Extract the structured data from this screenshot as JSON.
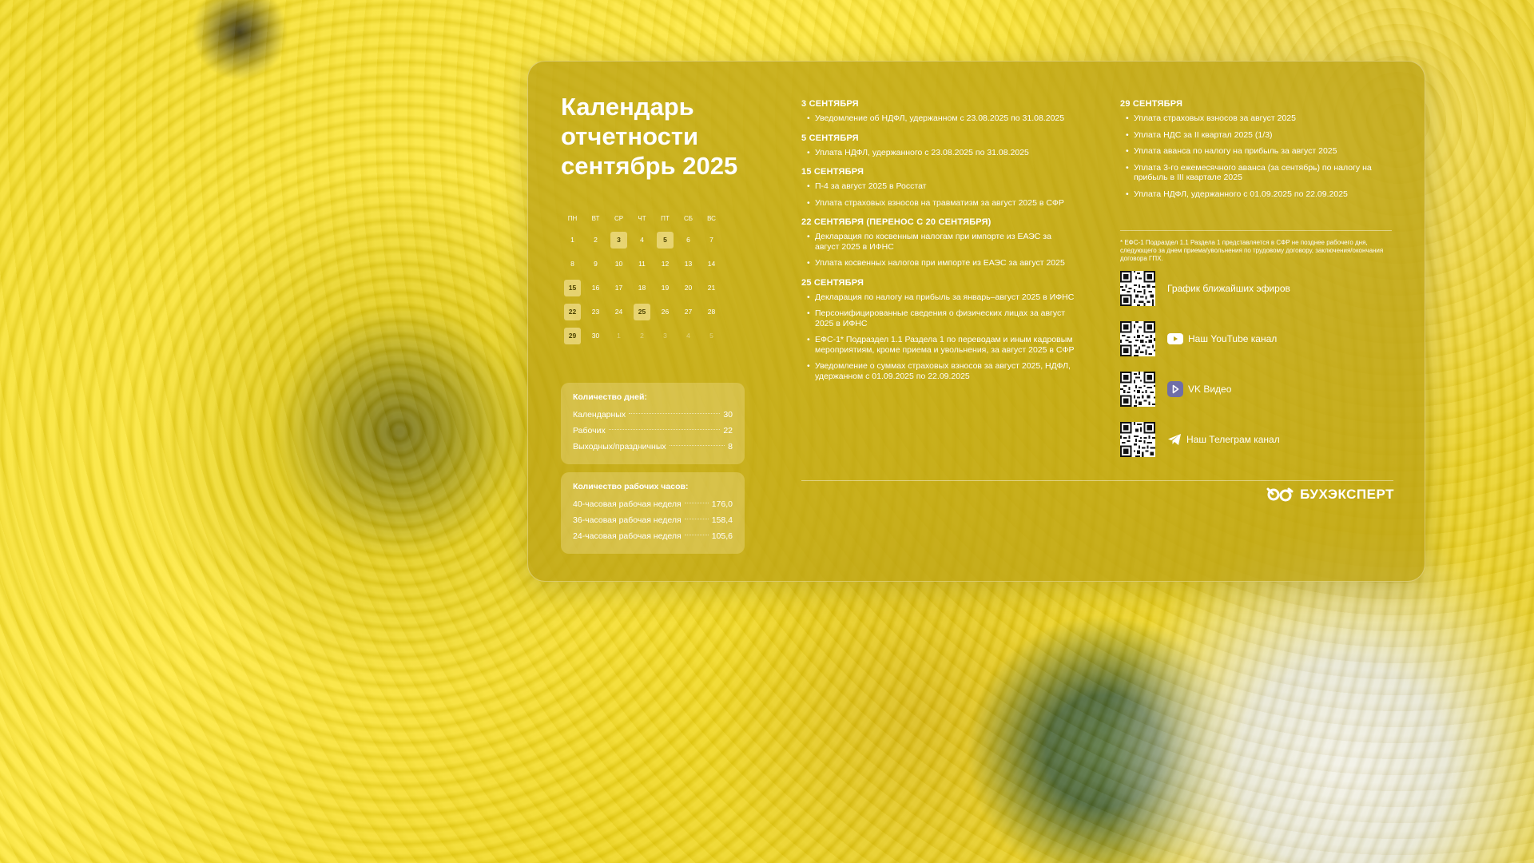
{
  "title": {
    "line1": "Календарь",
    "line2": "отчетности",
    "line3": "сентябрь 2025"
  },
  "calendar": {
    "weekdays": [
      "пн",
      "вт",
      "ср",
      "чт",
      "пт",
      "сб",
      "вс"
    ],
    "weeks": [
      [
        "1",
        "2",
        "3",
        "4",
        "5",
        "6",
        "7"
      ],
      [
        "8",
        "9",
        "10",
        "11",
        "12",
        "13",
        "14"
      ],
      [
        "15",
        "16",
        "17",
        "18",
        "19",
        "20",
        "21"
      ],
      [
        "22",
        "23",
        "24",
        "25",
        "26",
        "27",
        "28"
      ],
      [
        "29",
        "30",
        "1",
        "2",
        "3",
        "4",
        "5"
      ]
    ]
  },
  "days_count": {
    "heading": "Количество дней:",
    "rows": [
      {
        "label": "Календарных",
        "value": "30"
      },
      {
        "label": "Рабочих",
        "value": "22"
      },
      {
        "label": "Выходных/праздничных",
        "value": "8"
      }
    ]
  },
  "hours_count": {
    "heading": "Количество рабочих часов:",
    "rows": [
      {
        "label": "40-часовая рабочая неделя",
        "value": "176,0"
      },
      {
        "label": "36-часовая рабочая неделя",
        "value": "158,4"
      },
      {
        "label": "24-часовая рабочая неделя",
        "value": "105,6"
      }
    ]
  },
  "sections_left": [
    {
      "date": "3 сентября",
      "items": [
        "Уведомление об НДФЛ, удержанном с 23.08.2025 по 31.08.2025"
      ]
    },
    {
      "date": "5 сентября",
      "items": [
        "Уплата НДФЛ, удержанного с 23.08.2025 по 31.08.2025"
      ]
    },
    {
      "date": "15 сентября",
      "items": [
        "П-4 за август 2025 в Росстат",
        "Уплата страховых взносов на травматизм за август 2025 в СФР"
      ]
    },
    {
      "date": "22 сентября (перенос с 20 сентября)",
      "items": [
        "Декларация по косвенным налогам при импорте из ЕАЭС за август 2025 в ИФНС",
        "Уплата косвенных налогов при импорте из ЕАЭС за август 2025"
      ]
    },
    {
      "date": "25 сентября",
      "items": [
        "Декларация по налогу на прибыль за январь–август 2025 в ИФНС",
        "Персонифицированные сведения о физических лицах за август 2025 в ИФНС",
        "ЕФС-1* Подраздел 1.1 Раздела 1 по переводам и иным кадровым мероприятиям, кроме приема и увольнения, за август 2025 в СФР",
        "Уведомление о суммах страховых взносов за август 2025, НДФЛ, удержанном с 01.09.2025 по 22.09.2025"
      ]
    }
  ],
  "sections_right": [
    {
      "date": "29 сентября",
      "items": [
        "Уплата страховых взносов за август 2025",
        "Уплата НДС за II квартал 2025 (1/3)",
        "Уплата аванса по налогу на прибыль за август 2025",
        "Уплата 3-го ежемесячного аванса (за сентябрь) по налогу на прибыль в III квартале 2025",
        "Уплата НДФЛ, удержанного с 01.09.2025 по 22.09.2025"
      ]
    }
  ],
  "footnote": "* ЕФС-1 Подраздел 1.1 Раздела 1 представляется в СФР не позднее рабочего дня, следующего за днем приема/увольнения по трудовому договору, заключения/окончания договора ГПХ.",
  "links": [
    {
      "label": "График ближайших эфиров",
      "icon": "none"
    },
    {
      "label": "Наш YouTube канал",
      "icon": "youtube-icon"
    },
    {
      "label": "VK Видео",
      "icon": "vk-video-icon"
    },
    {
      "label": "Наш Телеграм канал",
      "icon": "telegram-icon"
    }
  ],
  "brand": {
    "name": "БУХЭКСПЕРТ",
    "icon": "buhexpert-logo-icon"
  },
  "colors": {
    "panel": "#bca314",
    "text": "#ffffff",
    "highlight": "#f7ecb4",
    "background": "#f2da1a"
  }
}
